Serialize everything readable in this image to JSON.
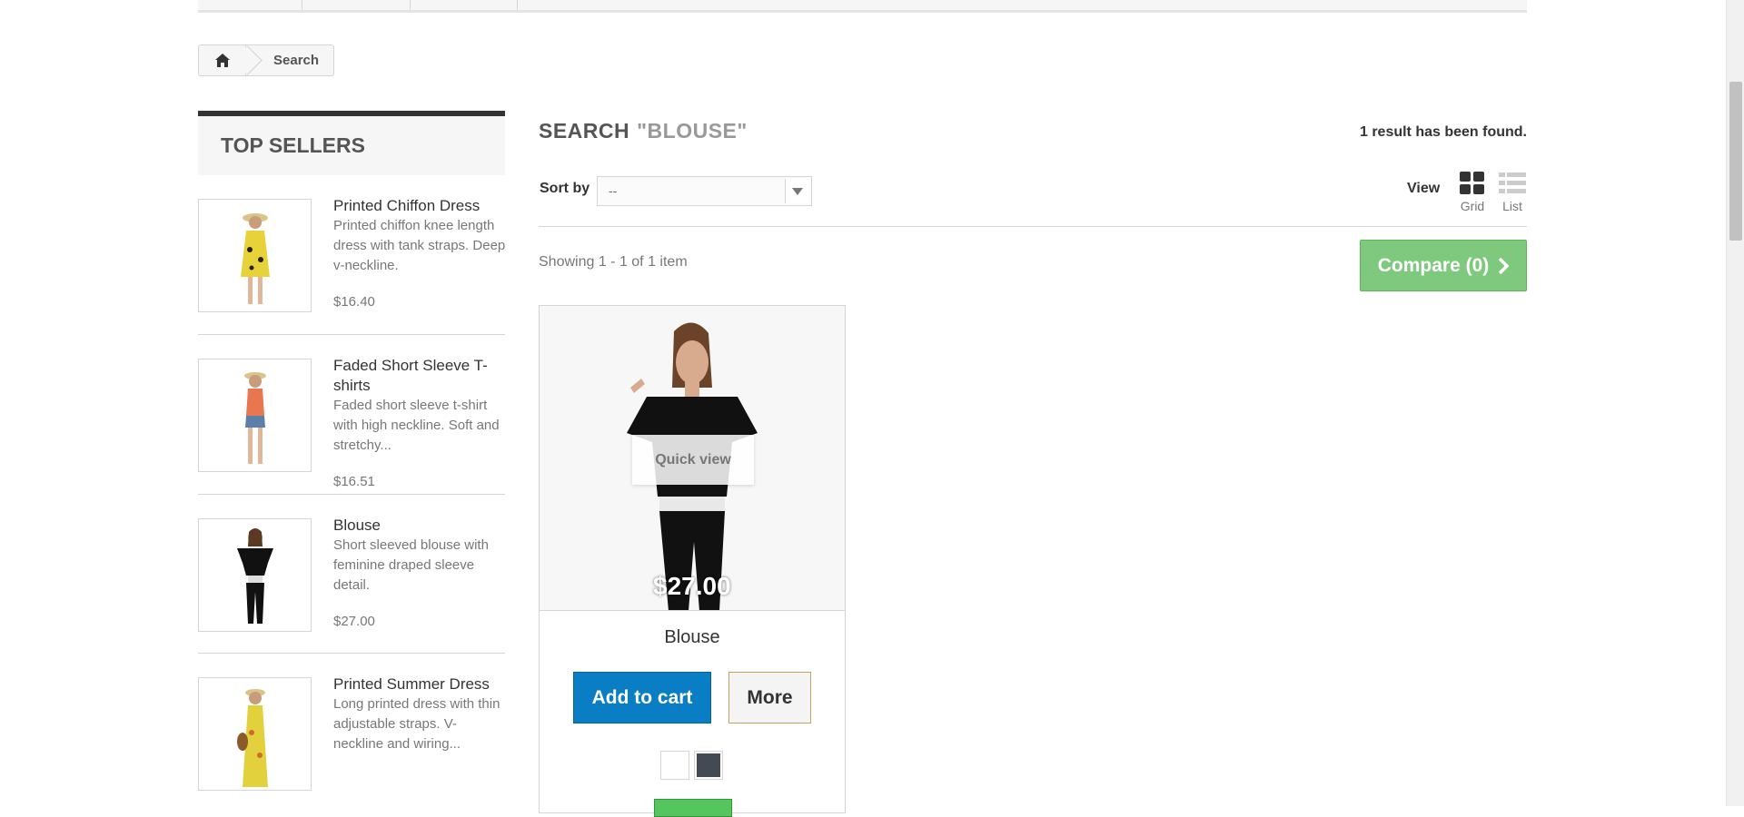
{
  "breadcrumb": {
    "home_icon": "home-icon",
    "current": "Search"
  },
  "sidebar": {
    "title": "TOP SELLERS",
    "items": [
      {
        "name": "Printed Chiffon Dress",
        "desc": "Printed chiffon knee length dress with tank straps. Deep v-neckline.",
        "price": "$16.40",
        "dress_color": "#e8d23a",
        "top_color": "#e8d23a"
      },
      {
        "name": "Faded Short Sleeve T-shirts",
        "desc": "Faded short sleeve t-shirt with high neckline. Soft and stretchy...",
        "price": "$16.51",
        "dress_color": "#5a7fa8",
        "top_color": "#e8764e"
      },
      {
        "name": "Blouse",
        "desc": "Short sleeved blouse with feminine draped sleeve detail.",
        "price": "$27.00",
        "dress_color": "#111111",
        "top_color": "#111111"
      },
      {
        "name": "Printed Summer Dress",
        "desc": "Long printed dress with thin adjustable straps. V-neckline and wiring...",
        "price": "",
        "dress_color": "#e2d03c",
        "top_color": "#e2d03c"
      }
    ]
  },
  "main": {
    "heading": "SEARCH",
    "query": "\"BLOUSE\"",
    "result_count": "1 result has been found.",
    "sort_label": "Sort by",
    "sort_value": "--",
    "view_label": "View",
    "view_grid": "Grid",
    "view_list": "List",
    "showing": "Showing 1 - 1 of 1 item",
    "compare": "Compare (0)"
  },
  "product": {
    "name": "Blouse",
    "image_price": "$27.00",
    "quick_view": "Quick view",
    "add_to_cart": "Add to cart",
    "more": "More",
    "colors": [
      "#ffffff",
      "#434a54"
    ],
    "stock_color": "#55c65e"
  },
  "colors": {
    "accent_blue": "#0a7ec4",
    "compare_green": "#7fc97f",
    "border": "#d6d4d4"
  }
}
